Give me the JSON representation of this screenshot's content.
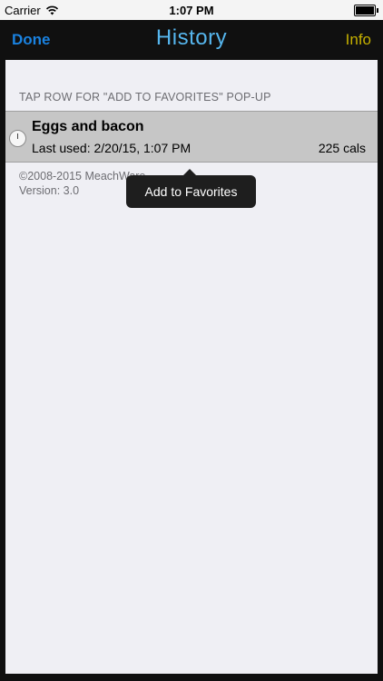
{
  "status_bar": {
    "carrier": "Carrier",
    "time": "1:07 PM",
    "wifi_icon": "wifi-icon",
    "battery_icon": "battery-icon"
  },
  "nav": {
    "left_button": "Done",
    "title": "History",
    "right_button": "Info",
    "colors": {
      "done": "#1a82e0",
      "title": "#56b6ee",
      "info": "#c5b000"
    }
  },
  "section_header": "TAP ROW FOR \"ADD TO FAVORITES\" POP-UP",
  "history": [
    {
      "name": "Eggs and bacon",
      "last_used": "Last used: 2/20/15, 1:07 PM",
      "calories": "225 cals",
      "icon": "clock-icon"
    }
  ],
  "footer": {
    "copyright": "©2008-2015 MeachWare",
    "version": "Version: 3.0"
  },
  "popup": {
    "label": "Add to Favorites"
  }
}
